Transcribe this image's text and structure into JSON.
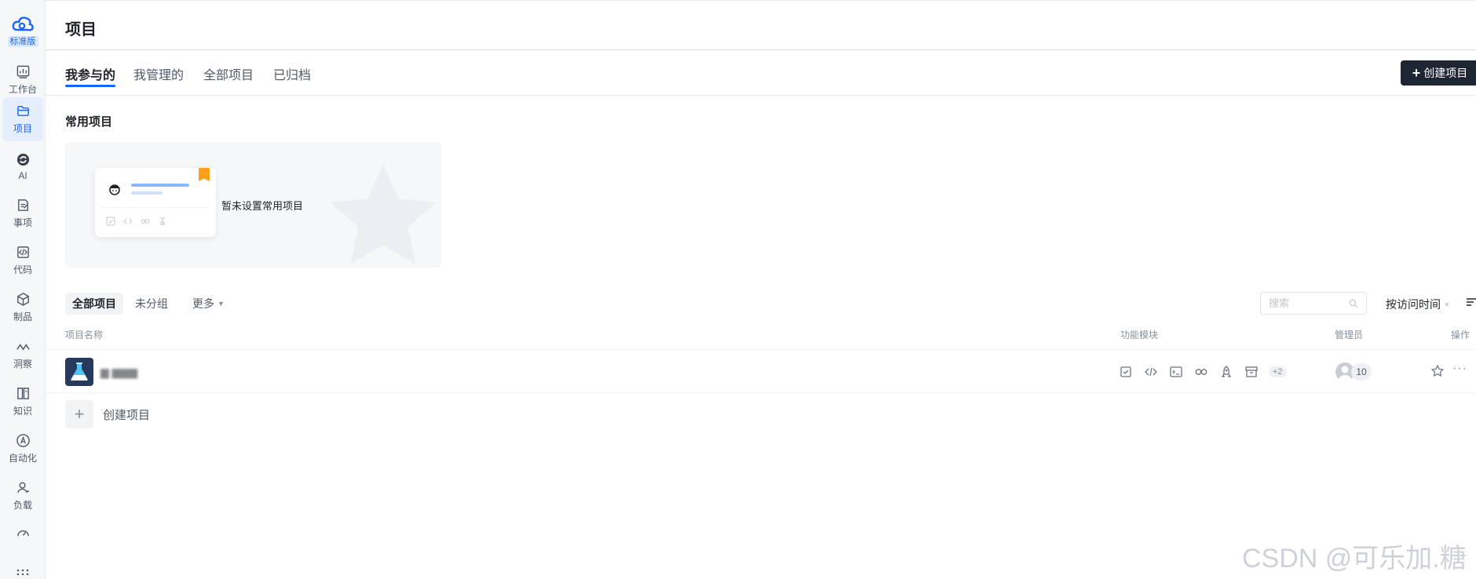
{
  "sidebar": {
    "edition_badge": "标准版",
    "items": [
      {
        "label": "工作台",
        "icon": "dashboard-icon"
      },
      {
        "label": "项目",
        "icon": "folder-icon",
        "active": true
      },
      {
        "label": "AI",
        "icon": "ai-icon"
      },
      {
        "label": "事项",
        "icon": "task-icon"
      },
      {
        "label": "代码",
        "icon": "code-icon"
      },
      {
        "label": "制品",
        "icon": "package-icon"
      },
      {
        "label": "洞察",
        "icon": "insight-icon"
      },
      {
        "label": "知识",
        "icon": "book-icon"
      },
      {
        "label": "自动化",
        "icon": "automation-icon"
      },
      {
        "label": "负载",
        "icon": "user-load-icon"
      },
      {
        "label": "",
        "icon": "gauge-icon"
      }
    ]
  },
  "header": {
    "title": "项目"
  },
  "tabs": {
    "items": [
      {
        "label": "我参与的",
        "active": true
      },
      {
        "label": "我管理的"
      },
      {
        "label": "全部项目"
      },
      {
        "label": "已归档"
      }
    ],
    "create_button": "创建项目"
  },
  "frequent": {
    "title": "常用项目",
    "empty_text": "暂未设置常用项目"
  },
  "filters": {
    "items": [
      {
        "label": "全部项目",
        "active": true
      },
      {
        "label": "未分组"
      },
      {
        "label": "更多"
      }
    ],
    "search_placeholder": "搜索",
    "sort_label": "按访问时间"
  },
  "table": {
    "columns": [
      "项目名称",
      "功能模块",
      "管理员",
      "操作"
    ],
    "rows": [
      {
        "name": "▆ ▆▆▆",
        "modules": [
          "check-icon",
          "code-icon",
          "terminal-icon",
          "pipeline-icon",
          "rocket-icon",
          "archive-icon"
        ],
        "modules_more": "+2",
        "admin_count": "10"
      }
    ]
  },
  "add_project_label": "创建项目",
  "watermark": "CSDN @可乐加.糖",
  "colors": {
    "accent": "#1664ff",
    "dark_button": "#1f2633",
    "bookmark": "#ff9f1a"
  }
}
